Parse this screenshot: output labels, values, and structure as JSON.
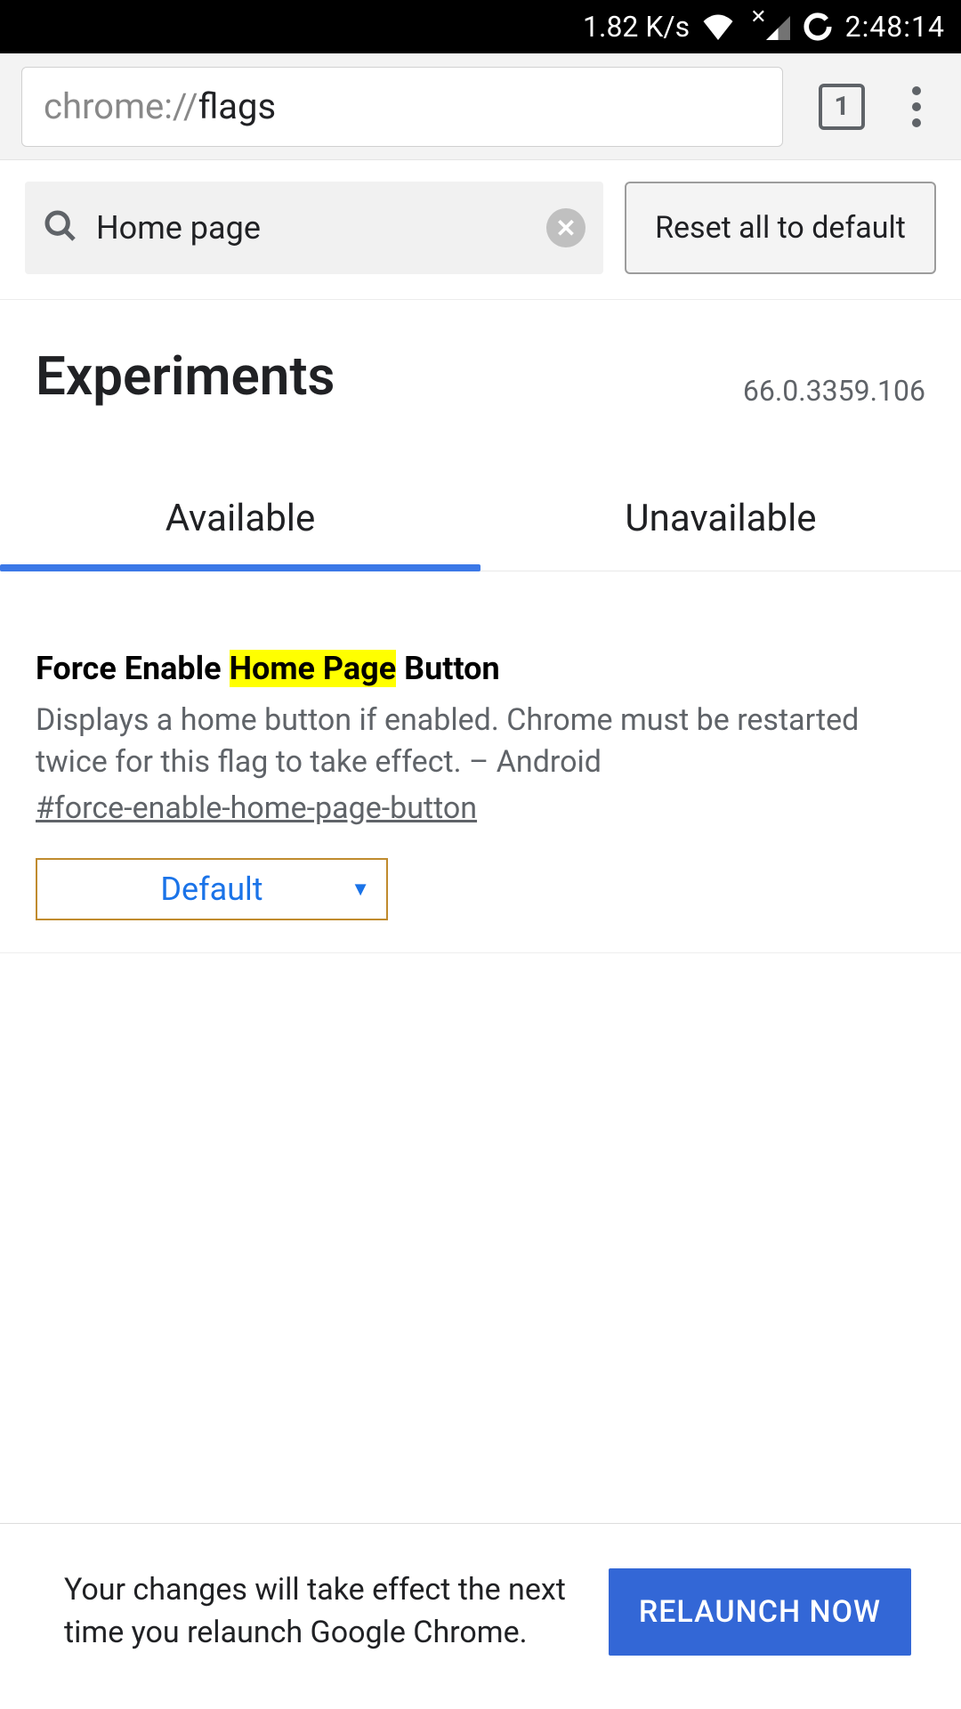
{
  "statusbar": {
    "speed": "1.82 K/s",
    "clock": "2:48:14"
  },
  "omnibar": {
    "url_scheme": "chrome://",
    "url_path": "flags",
    "tab_count": "1"
  },
  "flags_search": {
    "query": "Home page",
    "reset_label": "Reset all to default"
  },
  "header": {
    "title": "Experiments",
    "version": "66.0.3359.106"
  },
  "tabs": {
    "available": "Available",
    "unavailable": "Unavailable"
  },
  "flag": {
    "title_pre": "Force Enable ",
    "title_hl": "Home Page",
    "title_post": " Button",
    "description": "Displays a home button if enabled. Chrome must be restarted twice for this flag to take effect. – Android",
    "hash": "#force-enable-home-page-button",
    "select_value": "Default"
  },
  "relaunch": {
    "message": "Your changes will take effect the next time you relaunch Google Chrome.",
    "button": "RELAUNCH NOW"
  }
}
